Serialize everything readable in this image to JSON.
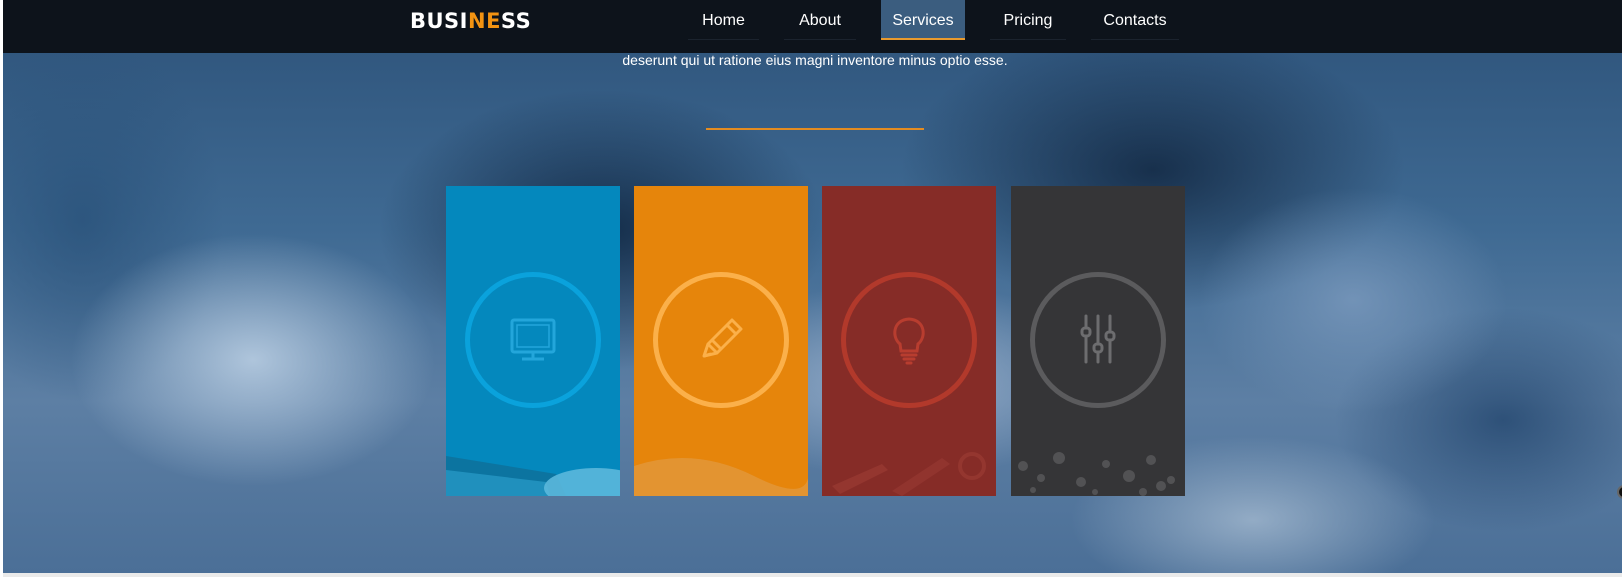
{
  "brand": {
    "logo_part1": "BUSI",
    "logo_accent": "NE",
    "logo_part2": "SS",
    "accent_color": "#f29312"
  },
  "nav": {
    "items": [
      {
        "label": "Home"
      },
      {
        "label": "About"
      },
      {
        "label": "Services",
        "active": true
      },
      {
        "label": "Pricing"
      },
      {
        "label": "Contacts"
      }
    ]
  },
  "hero": {
    "text": "deserunt qui ut ratione eius magni inventore minus optio esse."
  },
  "services": {
    "cards": [
      {
        "color": "#0488bd",
        "icon": "monitor-icon"
      },
      {
        "color": "#e6850b",
        "icon": "pencil-icon"
      },
      {
        "color": "#862c27",
        "icon": "lightbulb-icon"
      },
      {
        "color": "#353537",
        "icon": "equalizer-sliders-icon"
      }
    ]
  }
}
